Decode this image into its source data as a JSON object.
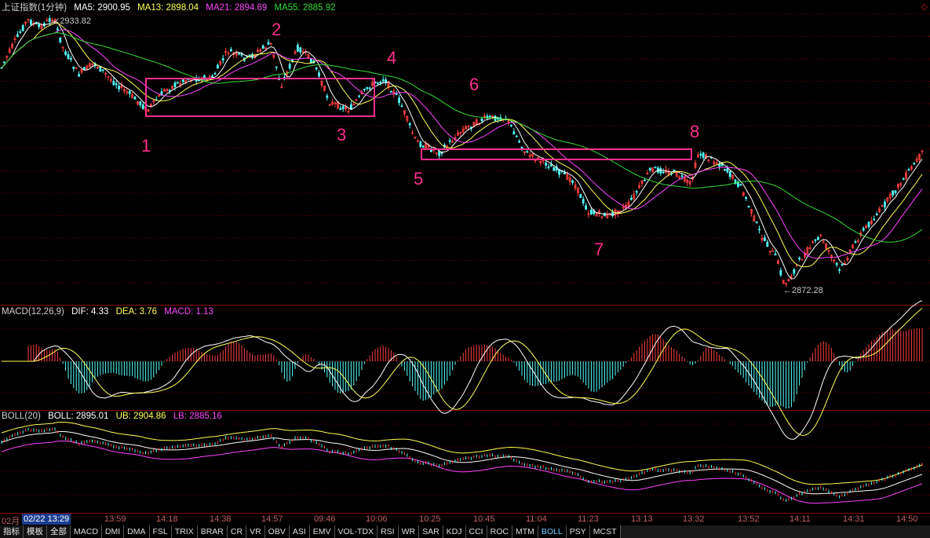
{
  "title": "上证指数(1分钟)",
  "ma": [
    {
      "label": "MA5: 2900.95",
      "color": "#ffffff"
    },
    {
      "label": "MA13: 2898.04",
      "color": "#ffff55"
    },
    {
      "label": "MA21: 2894.69",
      "color": "#ff44ff"
    },
    {
      "label": "MA55: 2885.92",
      "color": "#33dd33"
    }
  ],
  "high_label": "2933.82",
  "low_label": "←2872.28",
  "annotations": [
    "1",
    "2",
    "3",
    "4",
    "5",
    "6",
    "7",
    "8"
  ],
  "macd": {
    "name": "MACD(12,26,9)",
    "dif": "DIF: 4.33",
    "dea": "DEA: 3.76",
    "macd": "MACD: 1.13"
  },
  "boll": {
    "name": "BOLL(20)",
    "boll": "BOLL: 2895.01",
    "ub": "UB: 2904.86",
    "lb": "LB: 2885.16"
  },
  "time_axis": {
    "first": "02月",
    "cursor": "02/22 13:29",
    "ticks": [
      "13:59",
      "14:18",
      "14:38",
      "14:57",
      "09:46",
      "10:06",
      "10:25",
      "10:45",
      "11:04",
      "11:23",
      "13:13",
      "13:32",
      "13:52",
      "14:11",
      "14:31",
      "14:50"
    ]
  },
  "tabs": [
    "指标",
    "模板",
    "全部",
    "MACD",
    "DMI",
    "DMA",
    "FSL",
    "TRIX",
    "BRAR",
    "CR",
    "VR",
    "OBV",
    "ASI",
    "EMV",
    "VOL-TDX",
    "RSI",
    "WR",
    "SAR",
    "KDJ",
    "CCI",
    "ROC",
    "MTM",
    "BOLL",
    "PSY",
    "MCST"
  ],
  "selected_tab": "BOLL",
  "colors": {
    "up": "#ff4040",
    "down": "#55ffff",
    "grid": "#8b0000"
  }
}
